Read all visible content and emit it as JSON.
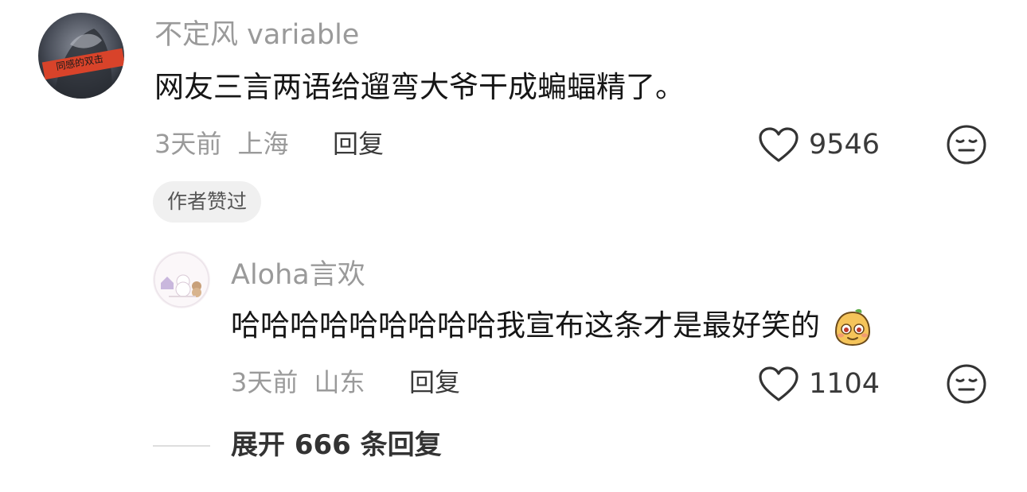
{
  "comment": {
    "username": "不定风 variable",
    "avatar_badge_text": "同感的双击",
    "text": "网友三言两语给遛弯大爷干成蝙蝠精了。",
    "time": "3天前",
    "location": "上海",
    "reply_label": "回复",
    "like_count": "9546",
    "author_badge": "作者赞过"
  },
  "reply": {
    "username": "Aloha言欢",
    "text": "哈哈哈哈哈哈哈哈哈我宣布这条才是最好笑的",
    "emoji_icon": "smiling-bun-emoji",
    "time": "3天前",
    "location": "山东",
    "reply_label": "回复",
    "like_count": "1104"
  },
  "expand_label": "展开 666 条回复",
  "colors": {
    "username": "#9a9a9a",
    "text": "#161616",
    "badge_bg": "#f0f0f0",
    "divider": "#dedede"
  },
  "icons": {
    "like": "heart-outline-icon",
    "dislike": "neutral-face-icon"
  }
}
